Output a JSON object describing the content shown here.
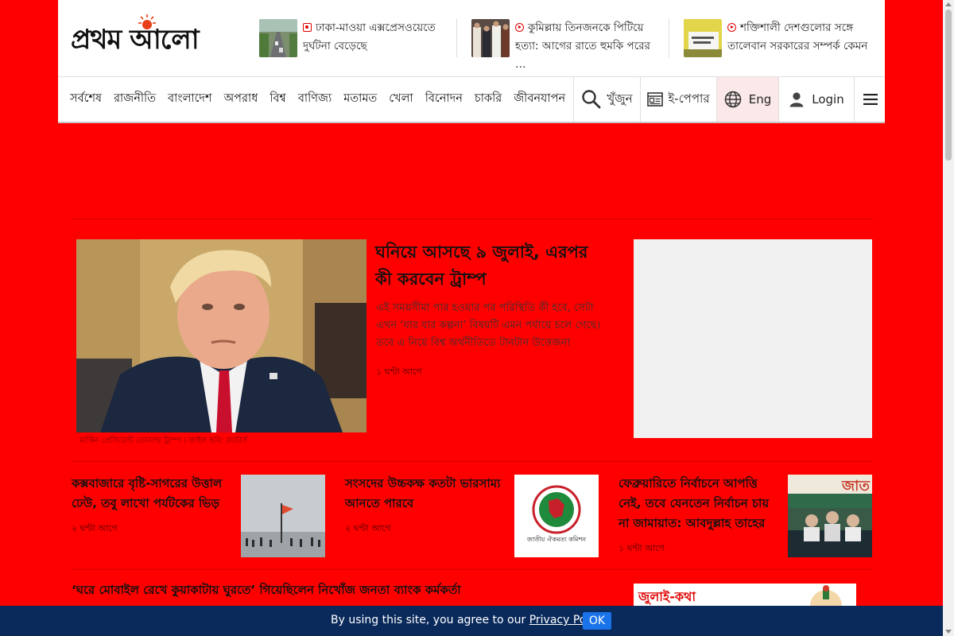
{
  "brand": {
    "name": "প্রথম আলো"
  },
  "top_news": [
    {
      "text": "ঢাকা-মাওয়া এক্সপ্রেসওয়েতে দুর্ঘটনা বেড়েছে",
      "icon": "camera-icon"
    },
    {
      "text": "কুমিল্লায় তিনজনকে পিটিয়ে হত্যা: আগের রাতে হুমকি পরের …",
      "icon": "play-icon"
    },
    {
      "text": "শক্তিশালী দেশগুলোর সঙ্গে তালেবান সরকারের সম্পর্ক কেমন",
      "icon": "play-icon"
    }
  ],
  "nav": {
    "items": [
      "সর্বশেষ",
      "রাজনীতি",
      "বাংলাদেশ",
      "অপরাধ",
      "বিশ্ব",
      "বাণিজ্য",
      "মতামত",
      "খেলা",
      "বিনোদন",
      "চাকরি",
      "জীবনযাপন"
    ],
    "search_label": "খুঁজুন",
    "epaper_label": "ই-পেপার",
    "lang_label": "Eng",
    "login_label": "Login"
  },
  "lead": {
    "title": "ঘনিয়ে আসছে ৯ জুলাই, এরপর কী করবেন ট্রাম্প",
    "summary": "এই সময়সীমা পার হওয়ার পর পরিস্থিতি কী হবে, সেটা এখন ‘যার যার কল্পনা’ বিষয়টি এমন পর্যায়ে চলে গেছে। তবে এ নিয়ে বিশ্ব অর্থনীতিতে টানটান উত্তেজনা",
    "time": "১ ঘণ্টা আগে",
    "caption": "মার্কিন প্রেসিডেন্ট ডোনাল্ড ট্রাম্প । ফাইল ছবি: রয়টার্স"
  },
  "stories": [
    {
      "title": "কক্সবাজারে বৃষ্টি-সাগরের উত্তাল ঢেউ, তবু লাখো পর্যটকের ভিড়",
      "time": "২ ঘণ্টা আগে"
    },
    {
      "title": "সংসদের উচ্চকক্ষ কতটা ভারসাম্য আনতে পারবে",
      "time": "২ ঘণ্টা আগে"
    },
    {
      "title": "ফেব্রুয়ারিতে নির্বাচনে আপত্তি নেই, তবে যেনতেন নির্বাচন চায় না জামায়াত: আবদুল্লাহ তাহের",
      "time": "১ ঘণ্টা আগে"
    }
  ],
  "story3_image_text": "জাত",
  "commission_label": "জাতীয় ঐকমত্য কমিশন",
  "row3_title": "‘ঘরে মোবাইল রেখে কুয়াকাটায় ঘুরতে’ গিয়েছিলেন নিখোঁজ জনতা ব্যাংক কর্মকর্তা",
  "promo": {
    "text": "জুলাই-কথা"
  },
  "cookie": {
    "message": "By using this site, you agree to our",
    "link": "Privacy Policy",
    "suffix": ".",
    "ok": "OK"
  },
  "colors": {
    "page_bg": "#ff0000",
    "cookie_bg": "#0a2a5c",
    "ok_button": "#1a73e8"
  }
}
